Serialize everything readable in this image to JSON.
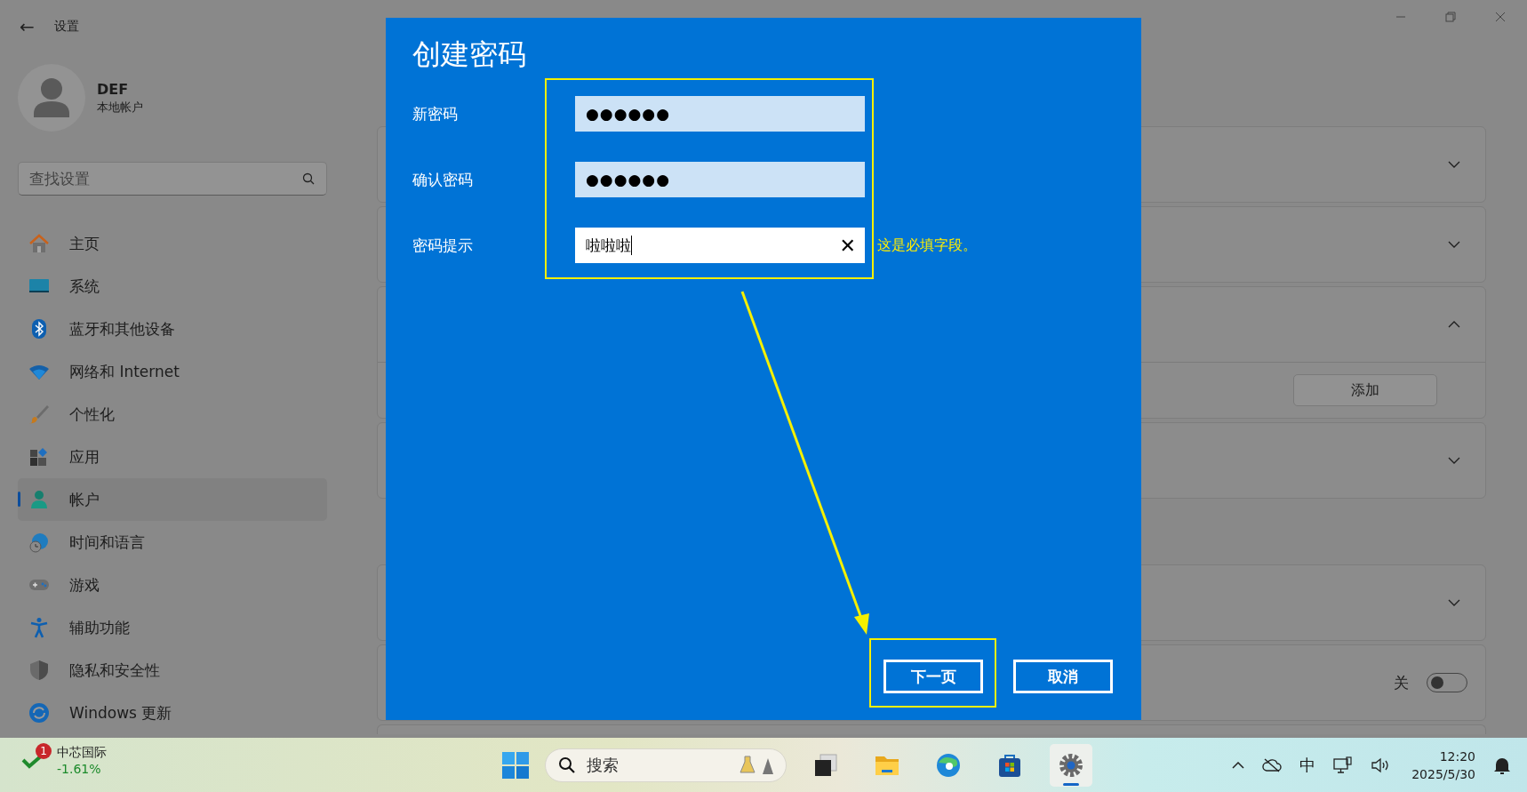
{
  "window": {
    "title": "设置",
    "back": "←"
  },
  "account": {
    "name": "DEF",
    "type": "本地帐户"
  },
  "search": {
    "placeholder": "查找设置"
  },
  "nav": [
    {
      "label": "主页",
      "selected": false
    },
    {
      "label": "系统",
      "selected": false
    },
    {
      "label": "蓝牙和其他设备",
      "selected": false
    },
    {
      "label": "网络和 Internet",
      "selected": false
    },
    {
      "label": "个性化",
      "selected": false
    },
    {
      "label": "应用",
      "selected": false
    },
    {
      "label": "帐户",
      "selected": true
    },
    {
      "label": "时间和语言",
      "selected": false
    },
    {
      "label": "游戏",
      "selected": false
    },
    {
      "label": "辅助功能",
      "selected": false
    },
    {
      "label": "隐私和安全性",
      "selected": false
    },
    {
      "label": "Windows 更新",
      "selected": false
    }
  ],
  "cards_top": [
    {
      "expanded": false
    },
    {
      "expanded": false
    },
    {
      "expanded": true,
      "button": "添加"
    },
    {
      "expanded": false
    }
  ],
  "cards_bottom": [
    {
      "kind": "plain",
      "expanded": false
    },
    {
      "kind": "toggle",
      "state_label": "关",
      "on": false
    }
  ],
  "dialog": {
    "title": "创建密码",
    "fields": [
      {
        "label": "新密码",
        "kind": "password",
        "value": "●●●●●●"
      },
      {
        "label": "确认密码",
        "kind": "password",
        "value": "●●●●●●"
      },
      {
        "label": "密码提示",
        "kind": "text",
        "value": "啦啦啦",
        "clear": "✕",
        "error": "这是必填字段。"
      }
    ],
    "buttons": [
      "下一页",
      "取消"
    ]
  },
  "taskbar": {
    "stock": {
      "badge": "1",
      "name": "中芯国际",
      "change": "-1.61%"
    },
    "search_placeholder": "搜索",
    "apps": [
      {
        "selected": false
      },
      {
        "selected": false
      },
      {
        "selected": false
      },
      {
        "selected": false
      },
      {
        "selected": true
      }
    ],
    "ime": "中",
    "time": "12:20",
    "date": "2025/5/30"
  }
}
